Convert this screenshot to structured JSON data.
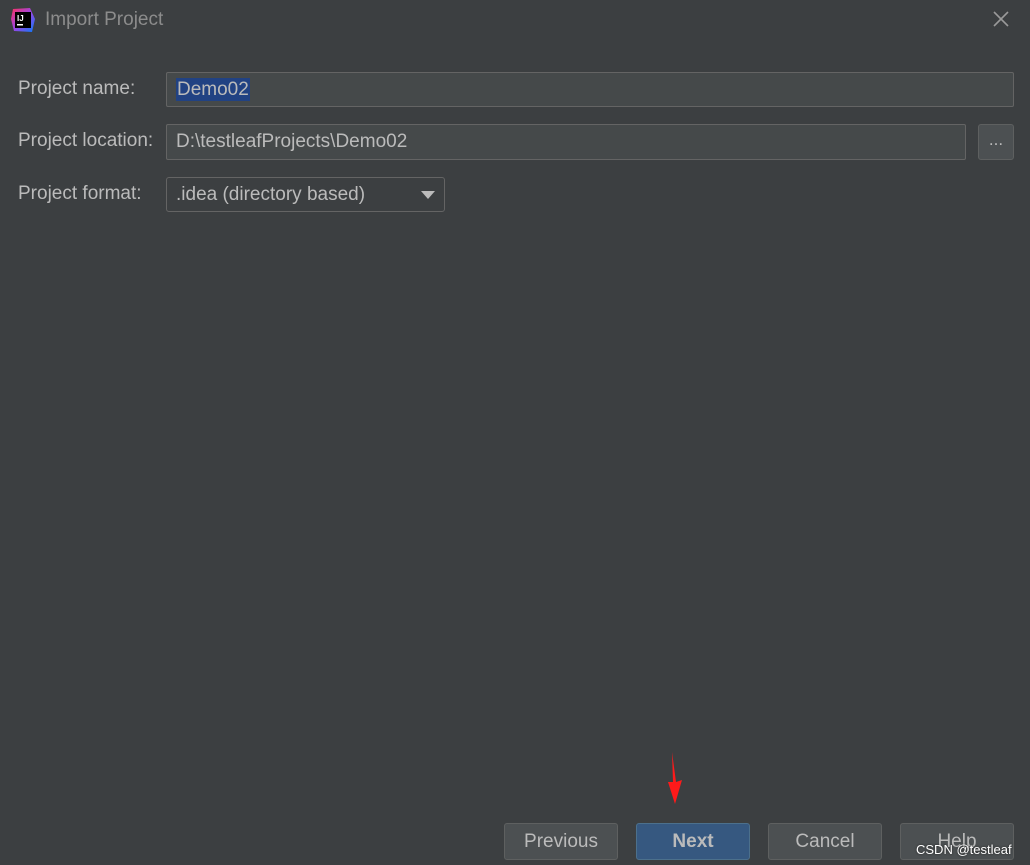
{
  "window": {
    "title": "Import Project",
    "icon": "intellij-idea-icon",
    "icon_text": "IJ"
  },
  "form": {
    "name_label": "Project name:",
    "name_value": "Demo02",
    "location_label": "Project location:",
    "location_value": "D:\\testleafProjects\\Demo02",
    "browse_label": "...",
    "format_label": "Project format:",
    "format_selected": ".idea (directory based)"
  },
  "buttons": {
    "previous": "Previous",
    "next": "Next",
    "cancel": "Cancel",
    "help": "Help"
  },
  "annotation": {
    "arrow_color": "#ff1a1a"
  },
  "watermark": "CSDN @testleaf",
  "colors": {
    "background": "#3c3f41",
    "field_bg": "#45494a",
    "selection": "#214283",
    "primary_button": "#365880"
  }
}
